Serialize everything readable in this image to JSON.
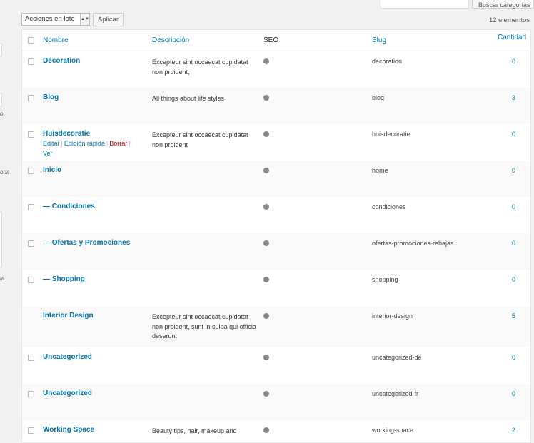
{
  "sidebar_fragments": [
    "o",
    "oria",
    "la"
  ],
  "search": {
    "button_label": "Buscar categorías"
  },
  "bulk": {
    "select_value": "Acciones en lote",
    "apply_label": "Aplicar",
    "items_count": "12 elementos"
  },
  "columns": {
    "name": "Nombre",
    "description": "Descripción",
    "seo": "SEO",
    "slug": "Slug",
    "count": "Cantidad"
  },
  "row_actions": {
    "edit": "Editar",
    "quick_edit": "Edición rápida",
    "delete": "Borrar",
    "view": "Ver"
  },
  "rows": [
    {
      "name": "Décoration",
      "description": "Excepteur sint occaecat cupidatat non proident,",
      "slug": "decoration",
      "count": "0"
    },
    {
      "name": "Blog",
      "description": "All things about life styles",
      "slug": "blog",
      "count": "3"
    },
    {
      "name": "Huisdecoratie",
      "description": "Excepteur sint occaecat cupidatat non proident",
      "slug": "huisdecoratie",
      "count": "0"
    },
    {
      "name": "Inicio",
      "description": "",
      "slug": "home",
      "count": "0"
    },
    {
      "name": "— Condiciones",
      "description": "",
      "slug": "condiciones",
      "count": "0"
    },
    {
      "name": "— Ofertas y Promociones",
      "description": "",
      "slug": "ofertas-promociones-rebajas",
      "count": "0"
    },
    {
      "name": "— Shopping",
      "description": "",
      "slug": "shopping",
      "count": "0"
    },
    {
      "name": "Interior Design",
      "description": "Excepteur sint occaecat cupidatat non proident, sunt in culpa qui officia deserunt",
      "slug": "interior-design",
      "count": "5"
    },
    {
      "name": "Uncategorized",
      "description": "",
      "slug": "uncategorized-de",
      "count": "0"
    },
    {
      "name": "Uncategorized",
      "description": "",
      "slug": "uncategorized-fr",
      "count": "0"
    },
    {
      "name": "Working Space",
      "description": "Beauty tips, hair, makeup and",
      "slug": "working-space",
      "count": "2"
    }
  ]
}
